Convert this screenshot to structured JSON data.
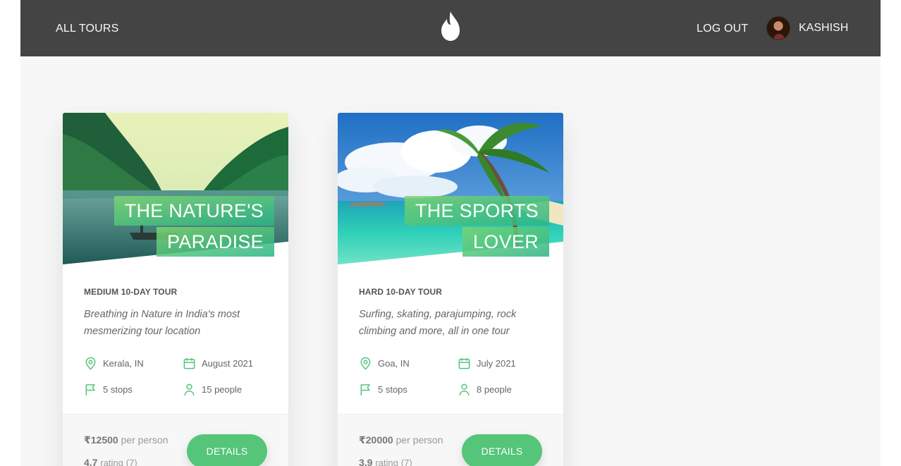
{
  "header": {
    "all_tours_label": "ALL TOURS",
    "logout_label": "LOG OUT",
    "user_name": "KASHISH",
    "logo_icon": "flame-logo-icon"
  },
  "colors": {
    "header_bg": "#444444",
    "accent_green": "#55c57a",
    "page_bg": "#f7f7f7"
  },
  "tours": [
    {
      "title_line1": "THE NATURE'S",
      "title_line2": "PARADISE",
      "difficulty_duration": "MEDIUM 10-DAY TOUR",
      "summary": "Breathing in Nature in India's most mesmerizing tour location",
      "location": "Kerala, IN",
      "date": "August 2021",
      "stops": "5 stops",
      "people": "15 people",
      "price": "₹12500",
      "price_unit": "per person",
      "rating": "4.7",
      "rating_label": "rating",
      "rating_count": "(7)",
      "button_label": "DETAILS"
    },
    {
      "title_line1": "THE SPORTS",
      "title_line2": "LOVER",
      "difficulty_duration": "HARD 10-DAY TOUR",
      "summary": "Surfing, skating, parajumping, rock climbing and more, all in one tour",
      "location": "Goa, IN",
      "date": "July 2021",
      "stops": "5 stops",
      "people": "8 people",
      "price": "₹20000",
      "price_unit": "per person",
      "rating": "3.9",
      "rating_label": "rating",
      "rating_count": "(7)",
      "button_label": "DETAILS"
    }
  ]
}
